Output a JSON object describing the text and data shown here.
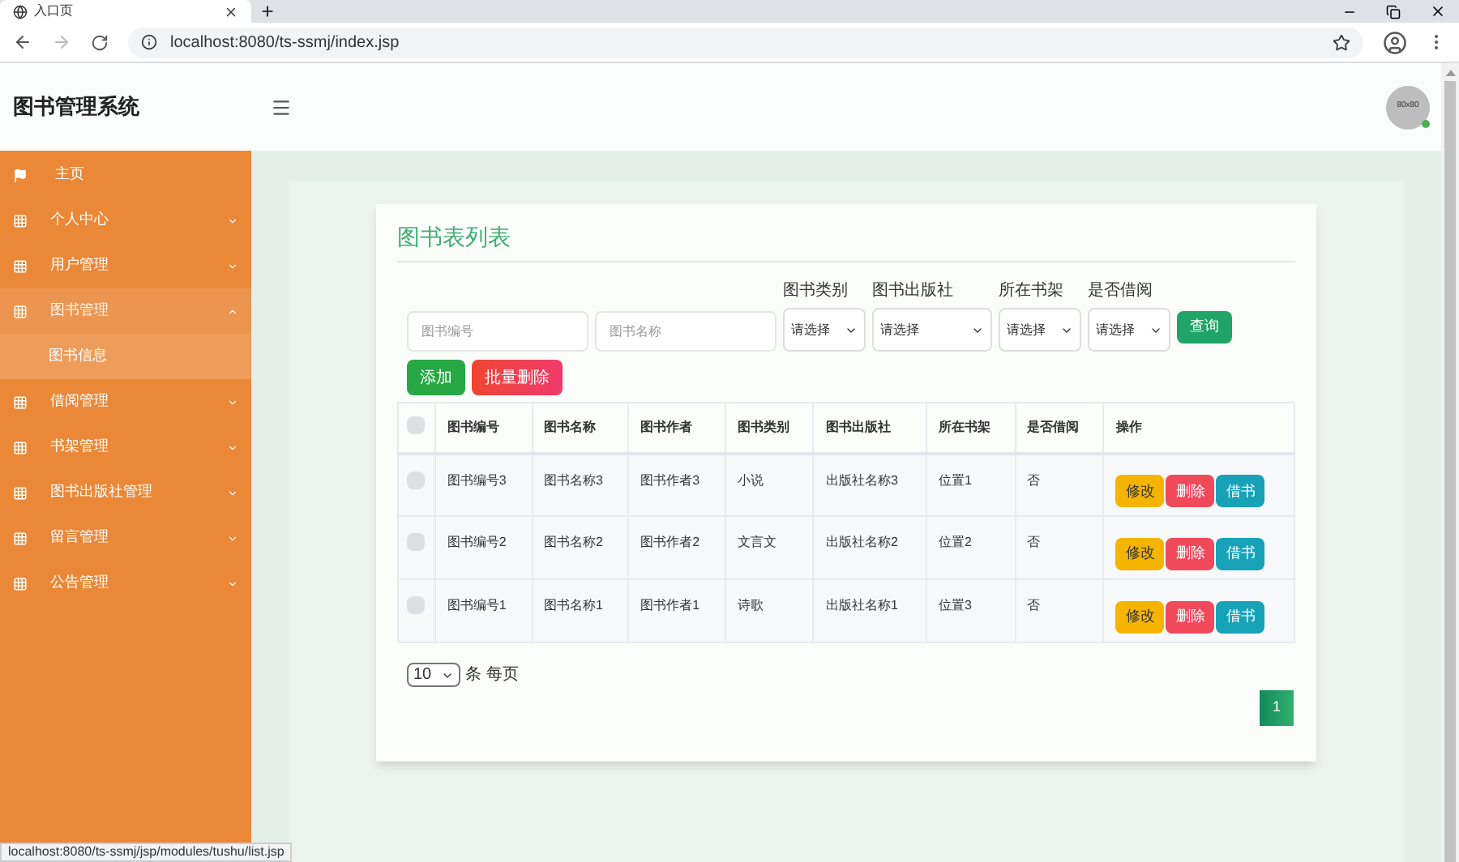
{
  "browser": {
    "tab_title": "入口页",
    "url": "localhost:8080/ts-ssmj/index.jsp",
    "status_url": "localhost:8080/ts-ssmj/jsp/modules/tushu/list.jsp"
  },
  "header": {
    "title": "图书管理系统",
    "avatar_text": "80x80",
    "online": true
  },
  "sidebar": {
    "items": [
      {
        "label": "主页",
        "kind": "home",
        "expanded": false,
        "selected": false
      },
      {
        "label": "个人中心",
        "kind": "group",
        "expanded": false,
        "selected": false
      },
      {
        "label": "用户管理",
        "kind": "group",
        "expanded": false,
        "selected": false
      },
      {
        "label": "图书管理",
        "kind": "group",
        "expanded": true,
        "selected": true,
        "children": [
          {
            "label": "图书信息",
            "selected": true
          }
        ]
      },
      {
        "label": "借阅管理",
        "kind": "group",
        "expanded": false,
        "selected": false
      },
      {
        "label": "书架管理",
        "kind": "group",
        "expanded": false,
        "selected": false
      },
      {
        "label": "图书出版社管理",
        "kind": "group",
        "expanded": false,
        "selected": false
      },
      {
        "label": "留言管理",
        "kind": "group",
        "expanded": false,
        "selected": false
      },
      {
        "label": "公告管理",
        "kind": "group",
        "expanded": false,
        "selected": false
      }
    ]
  },
  "card": {
    "title": "图书表列表",
    "filters": [
      {
        "kind": "input",
        "placeholder": "图书编号"
      },
      {
        "kind": "input",
        "placeholder": "图书名称"
      },
      {
        "kind": "select",
        "label": "图书类别",
        "value": "请选择"
      },
      {
        "kind": "select",
        "label": "图书出版社",
        "value": "请选择"
      },
      {
        "kind": "select",
        "label": "所在书架",
        "value": "请选择"
      },
      {
        "kind": "select",
        "label": "是否借阅",
        "value": "请选择"
      }
    ],
    "search_button": "查询",
    "actions": [
      {
        "label": "添加",
        "kind": "add"
      },
      {
        "label": "批量删除",
        "kind": "delete"
      }
    ],
    "table": {
      "select_all_checked": false,
      "columns": [
        "图书编号",
        "图书名称",
        "图书作者",
        "图书类别",
        "图书出版社",
        "所在书架",
        "是否借阅",
        "操作"
      ],
      "rows": [
        {
          "checked": false,
          "cells": [
            "图书编号3",
            "图书名称3",
            "图书作者3",
            "小说",
            "出版社名称3",
            "位置1",
            "否"
          ],
          "buttons": [
            {
              "label": "修改",
              "kind": "edit"
            },
            {
              "label": "删除",
              "kind": "delete"
            },
            {
              "label": "借书",
              "kind": "borrow"
            }
          ]
        },
        {
          "checked": false,
          "cells": [
            "图书编号2",
            "图书名称2",
            "图书作者2",
            "文言文",
            "出版社名称2",
            "位置2",
            "否"
          ],
          "buttons": [
            {
              "label": "修改",
              "kind": "edit"
            },
            {
              "label": "删除",
              "kind": "delete"
            },
            {
              "label": "借书",
              "kind": "borrow"
            }
          ]
        },
        {
          "checked": false,
          "cells": [
            "图书编号1",
            "图书名称1",
            "图书作者1",
            "诗歌",
            "出版社名称1",
            "位置3",
            "否"
          ],
          "buttons": [
            {
              "label": "修改",
              "kind": "edit"
            },
            {
              "label": "删除",
              "kind": "delete"
            },
            {
              "label": "借书",
              "kind": "borrow"
            }
          ]
        }
      ]
    },
    "page_size": {
      "value": "10",
      "label": "条 每页"
    },
    "pages": [
      {
        "label": "1",
        "selected": true
      }
    ]
  }
}
